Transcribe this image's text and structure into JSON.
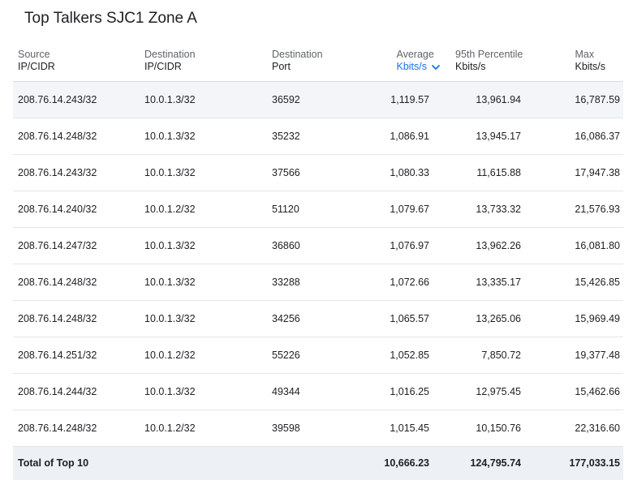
{
  "title": "Top Talkers SJC1 Zone A",
  "colors": {
    "accent": "#1a73e8",
    "header_text": "#5f6368",
    "row_highlight": "#f3f5f8",
    "total_bg": "#edf0f4"
  },
  "columns": {
    "source": {
      "line1": "Source",
      "line2": "IP/CIDR"
    },
    "destination": {
      "line1": "Destination",
      "line2": "IP/CIDR"
    },
    "port": {
      "line1": "Destination",
      "line2": "Port"
    },
    "average": {
      "line1": "Average",
      "line2": "Kbits/s",
      "sorted": "descending",
      "sort_icon": "chevron-down-icon"
    },
    "p95": {
      "line1": "95th Percentile",
      "line2": "Kbits/s"
    },
    "max": {
      "line1": "Max",
      "line2": "Kbits/s"
    }
  },
  "rows": [
    {
      "source": "208.76.14.243/32",
      "destination": "10.0.1.3/32",
      "port": "36592",
      "average": "1,119.57",
      "p95": "13,961.94",
      "max": "16,787.59"
    },
    {
      "source": "208.76.14.248/32",
      "destination": "10.0.1.3/32",
      "port": "35232",
      "average": "1,086.91",
      "p95": "13,945.17",
      "max": "16,086.37"
    },
    {
      "source": "208.76.14.243/32",
      "destination": "10.0.1.3/32",
      "port": "37566",
      "average": "1,080.33",
      "p95": "11,615.88",
      "max": "17,947.38"
    },
    {
      "source": "208.76.14.240/32",
      "destination": "10.0.1.2/32",
      "port": "51120",
      "average": "1,079.67",
      "p95": "13,733.32",
      "max": "21,576.93"
    },
    {
      "source": "208.76.14.247/32",
      "destination": "10.0.1.3/32",
      "port": "36860",
      "average": "1,076.97",
      "p95": "13,962.26",
      "max": "16,081.80"
    },
    {
      "source": "208.76.14.248/32",
      "destination": "10.0.1.3/32",
      "port": "33288",
      "average": "1,072.66",
      "p95": "13,335.17",
      "max": "15,426.85"
    },
    {
      "source": "208.76.14.248/32",
      "destination": "10.0.1.3/32",
      "port": "34256",
      "average": "1,065.57",
      "p95": "13,265.06",
      "max": "15,969.49"
    },
    {
      "source": "208.76.14.251/32",
      "destination": "10.0.1.2/32",
      "port": "55226",
      "average": "1,052.85",
      "p95": "7,850.72",
      "max": "19,377.48"
    },
    {
      "source": "208.76.14.244/32",
      "destination": "10.0.1.3/32",
      "port": "49344",
      "average": "1,016.25",
      "p95": "12,975.45",
      "max": "15,462.66"
    },
    {
      "source": "208.76.14.248/32",
      "destination": "10.0.1.2/32",
      "port": "39598",
      "average": "1,015.45",
      "p95": "10,150.76",
      "max": "22,316.60"
    }
  ],
  "total": {
    "label": "Total of Top 10",
    "average": "10,666.23",
    "p95": "124,795.74",
    "max": "177,033.15"
  }
}
